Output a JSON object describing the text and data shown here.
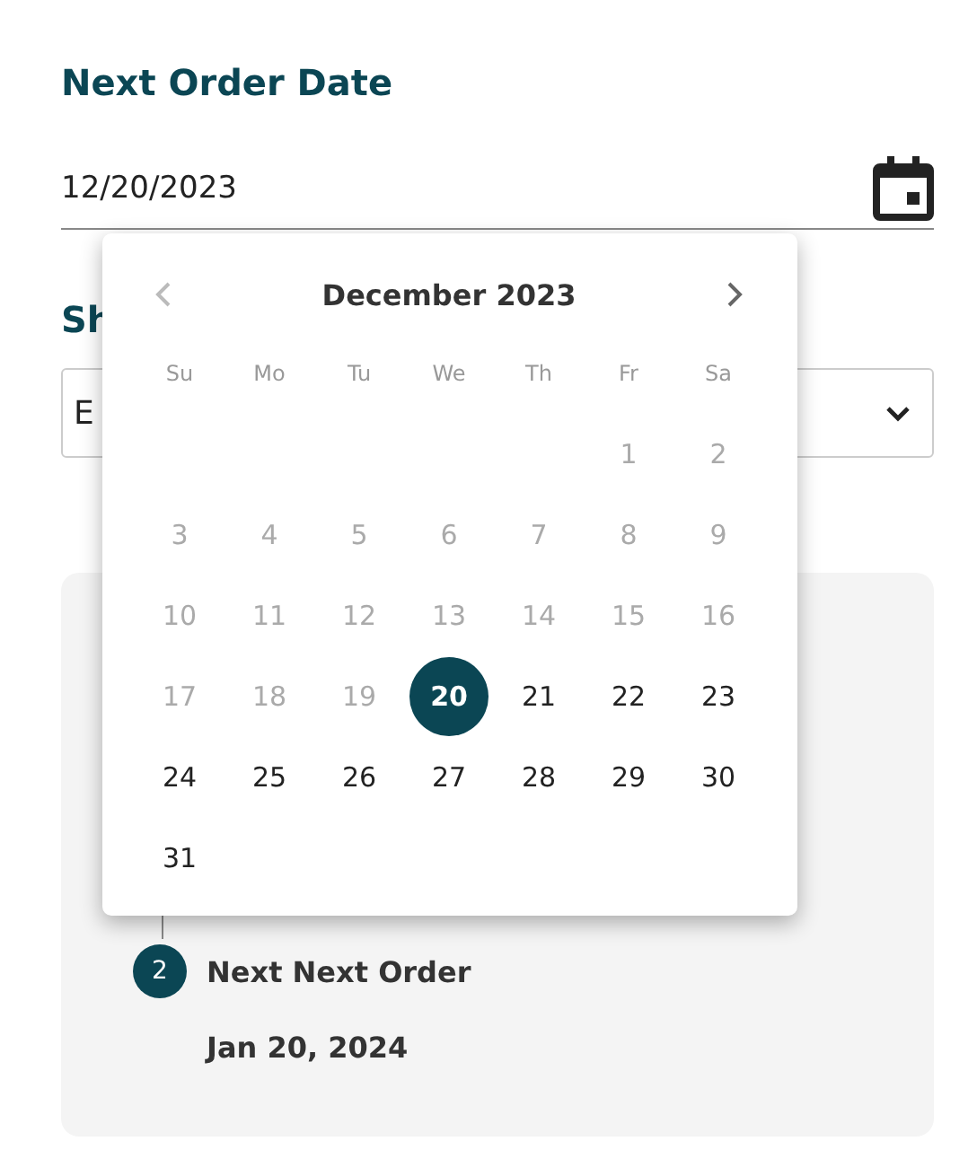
{
  "next_order_date": {
    "label": "Next Order Date",
    "value": "12/20/2023"
  },
  "ship_section": {
    "heading": "Sh",
    "select_value": "E"
  },
  "calendar": {
    "month": "December 2023",
    "prev_disabled": true,
    "next_disabled": false,
    "weekdays": [
      "Su",
      "Mo",
      "Tu",
      "We",
      "Th",
      "Fr",
      "Sa"
    ],
    "weeks": [
      [
        {
          "kind": "empty"
        },
        {
          "kind": "empty"
        },
        {
          "kind": "empty"
        },
        {
          "kind": "empty"
        },
        {
          "kind": "empty"
        },
        {
          "kind": "day",
          "label": "1",
          "disabled": true,
          "selected": false
        },
        {
          "kind": "day",
          "label": "2",
          "disabled": true,
          "selected": false
        }
      ],
      [
        {
          "kind": "day",
          "label": "3",
          "disabled": true,
          "selected": false
        },
        {
          "kind": "day",
          "label": "4",
          "disabled": true,
          "selected": false
        },
        {
          "kind": "day",
          "label": "5",
          "disabled": true,
          "selected": false
        },
        {
          "kind": "day",
          "label": "6",
          "disabled": true,
          "selected": false
        },
        {
          "kind": "day",
          "label": "7",
          "disabled": true,
          "selected": false
        },
        {
          "kind": "day",
          "label": "8",
          "disabled": true,
          "selected": false
        },
        {
          "kind": "day",
          "label": "9",
          "disabled": true,
          "selected": false
        }
      ],
      [
        {
          "kind": "day",
          "label": "10",
          "disabled": true,
          "selected": false
        },
        {
          "kind": "day",
          "label": "11",
          "disabled": true,
          "selected": false
        },
        {
          "kind": "day",
          "label": "12",
          "disabled": true,
          "selected": false
        },
        {
          "kind": "day",
          "label": "13",
          "disabled": true,
          "selected": false
        },
        {
          "kind": "day",
          "label": "14",
          "disabled": true,
          "selected": false
        },
        {
          "kind": "day",
          "label": "15",
          "disabled": true,
          "selected": false
        },
        {
          "kind": "day",
          "label": "16",
          "disabled": true,
          "selected": false
        }
      ],
      [
        {
          "kind": "day",
          "label": "17",
          "disabled": true,
          "selected": false
        },
        {
          "kind": "day",
          "label": "18",
          "disabled": true,
          "selected": false
        },
        {
          "kind": "day",
          "label": "19",
          "disabled": true,
          "selected": false
        },
        {
          "kind": "day",
          "label": "20",
          "disabled": false,
          "selected": true
        },
        {
          "kind": "day",
          "label": "21",
          "disabled": false,
          "selected": false
        },
        {
          "kind": "day",
          "label": "22",
          "disabled": false,
          "selected": false
        },
        {
          "kind": "day",
          "label": "23",
          "disabled": false,
          "selected": false
        }
      ],
      [
        {
          "kind": "day",
          "label": "24",
          "disabled": false,
          "selected": false
        },
        {
          "kind": "day",
          "label": "25",
          "disabled": false,
          "selected": false
        },
        {
          "kind": "day",
          "label": "26",
          "disabled": false,
          "selected": false
        },
        {
          "kind": "day",
          "label": "27",
          "disabled": false,
          "selected": false
        },
        {
          "kind": "day",
          "label": "28",
          "disabled": false,
          "selected": false
        },
        {
          "kind": "day",
          "label": "29",
          "disabled": false,
          "selected": false
        },
        {
          "kind": "day",
          "label": "30",
          "disabled": false,
          "selected": false
        }
      ],
      [
        {
          "kind": "day",
          "label": "31",
          "disabled": false,
          "selected": false
        }
      ]
    ]
  },
  "schedule": {
    "steps": [
      {
        "number": "2",
        "title": "Next Next Order",
        "date": "Jan 20, 2024"
      }
    ]
  }
}
